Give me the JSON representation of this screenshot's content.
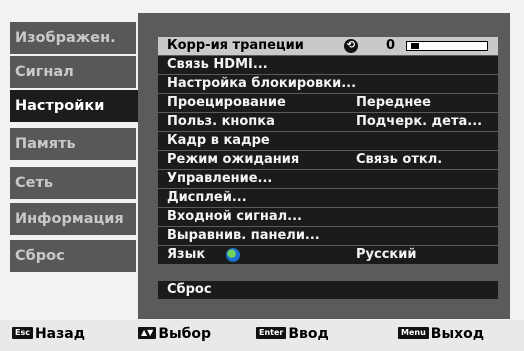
{
  "nav": {
    "items": [
      {
        "label": "Изображен.",
        "active": false
      },
      {
        "label": "Сигнал",
        "active": false
      },
      {
        "label": "Настройки",
        "active": true
      },
      {
        "label": "Память",
        "active": false
      },
      {
        "label": "Сеть",
        "active": false
      },
      {
        "label": "Информация",
        "active": false
      },
      {
        "label": "Сброс",
        "active": false
      }
    ]
  },
  "menu": {
    "keystone": {
      "label": "Корр-ия трапеции",
      "icon": "keystone-icon",
      "value": "0",
      "level": 0.02
    },
    "hdmi": {
      "label": "Связь HDMI..."
    },
    "lock": {
      "label": "Настройка блокировки..."
    },
    "projection": {
      "label": "Проецирование",
      "value": "Переднее"
    },
    "user_button": {
      "label": "Польз. кнопка",
      "value": "Подчерк. дета..."
    },
    "pip": {
      "label": "Кадр в кадре"
    },
    "standby": {
      "label": "Режим ожидания",
      "value": "Связь откл."
    },
    "control": {
      "label": "Управление..."
    },
    "display": {
      "label": "Дисплей..."
    },
    "input_signal": {
      "label": "Входной сигнал..."
    },
    "panel_align": {
      "label": "Выравнив. панели..."
    },
    "language": {
      "label": "Язык",
      "icon": "globe-icon",
      "value": "Русский"
    },
    "reset": {
      "label": "Сброс"
    }
  },
  "footer": {
    "esc_key": "Esc",
    "esc_label": "Назад",
    "select_key": "▲▼",
    "select_label": "Выбор",
    "enter_key": "Enter",
    "enter_label": "Ввод",
    "menu_key": "Menu",
    "menu_label": "Выход"
  }
}
